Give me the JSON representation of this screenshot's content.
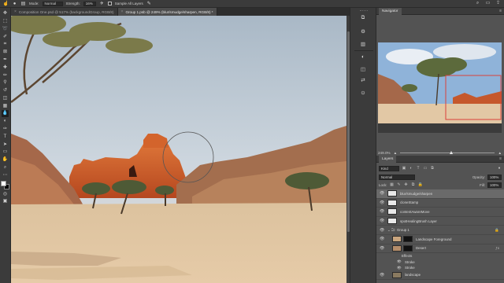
{
  "options_bar": {
    "mode_label": "Mode:",
    "mode_value": "Normal",
    "strength_label": "Strength:",
    "strength_value": "16%",
    "sample_all_layers": "Sample All Layers"
  },
  "tabs": [
    {
      "label": "Composition One.psd @ 517% (backgroundGroup, RGB/8)",
      "close": "×",
      "active": false
    },
    {
      "label": "Group 1.psb @ 249% (blur/smudge/sharpen, RGB/8) *",
      "close": "×",
      "active": true
    }
  ],
  "navigator": {
    "title": "Navigator",
    "zoom_value": "249.0%"
  },
  "layers_panel": {
    "title": "Layers",
    "kind_filter": "Kind",
    "blend_mode": "Normal",
    "opacity_label": "Opacity:",
    "opacity_value": "100%",
    "lock_label": "Lock:",
    "fill_label": "Fill:",
    "fill_value": "100%",
    "layers": [
      {
        "name": "blur/smudge/sharpen",
        "selected": true
      },
      {
        "name": "cloneStamp",
        "selected": false
      },
      {
        "name": "contentAwareMove",
        "selected": false
      },
      {
        "name": "spotHealingBrush Layer",
        "selected": false
      },
      {
        "name": "Group 1",
        "selected": false
      },
      {
        "name": "Landscape Foreground",
        "selected": false
      },
      {
        "name": "Desert",
        "selected": false
      },
      {
        "name": "Effects",
        "selected": false
      },
      {
        "name": "Stroke",
        "selected": false
      },
      {
        "name": "Stroke",
        "selected": false
      },
      {
        "name": "landscape",
        "selected": false
      }
    ]
  },
  "colors": {
    "panel_bg": "#535353",
    "toolbar_bg": "#3b3b3b",
    "selected_layer": "#6a6a6a",
    "sky": "#c9d3dc",
    "sand": "#e2c7a3",
    "red_rock": "#c5582c"
  }
}
